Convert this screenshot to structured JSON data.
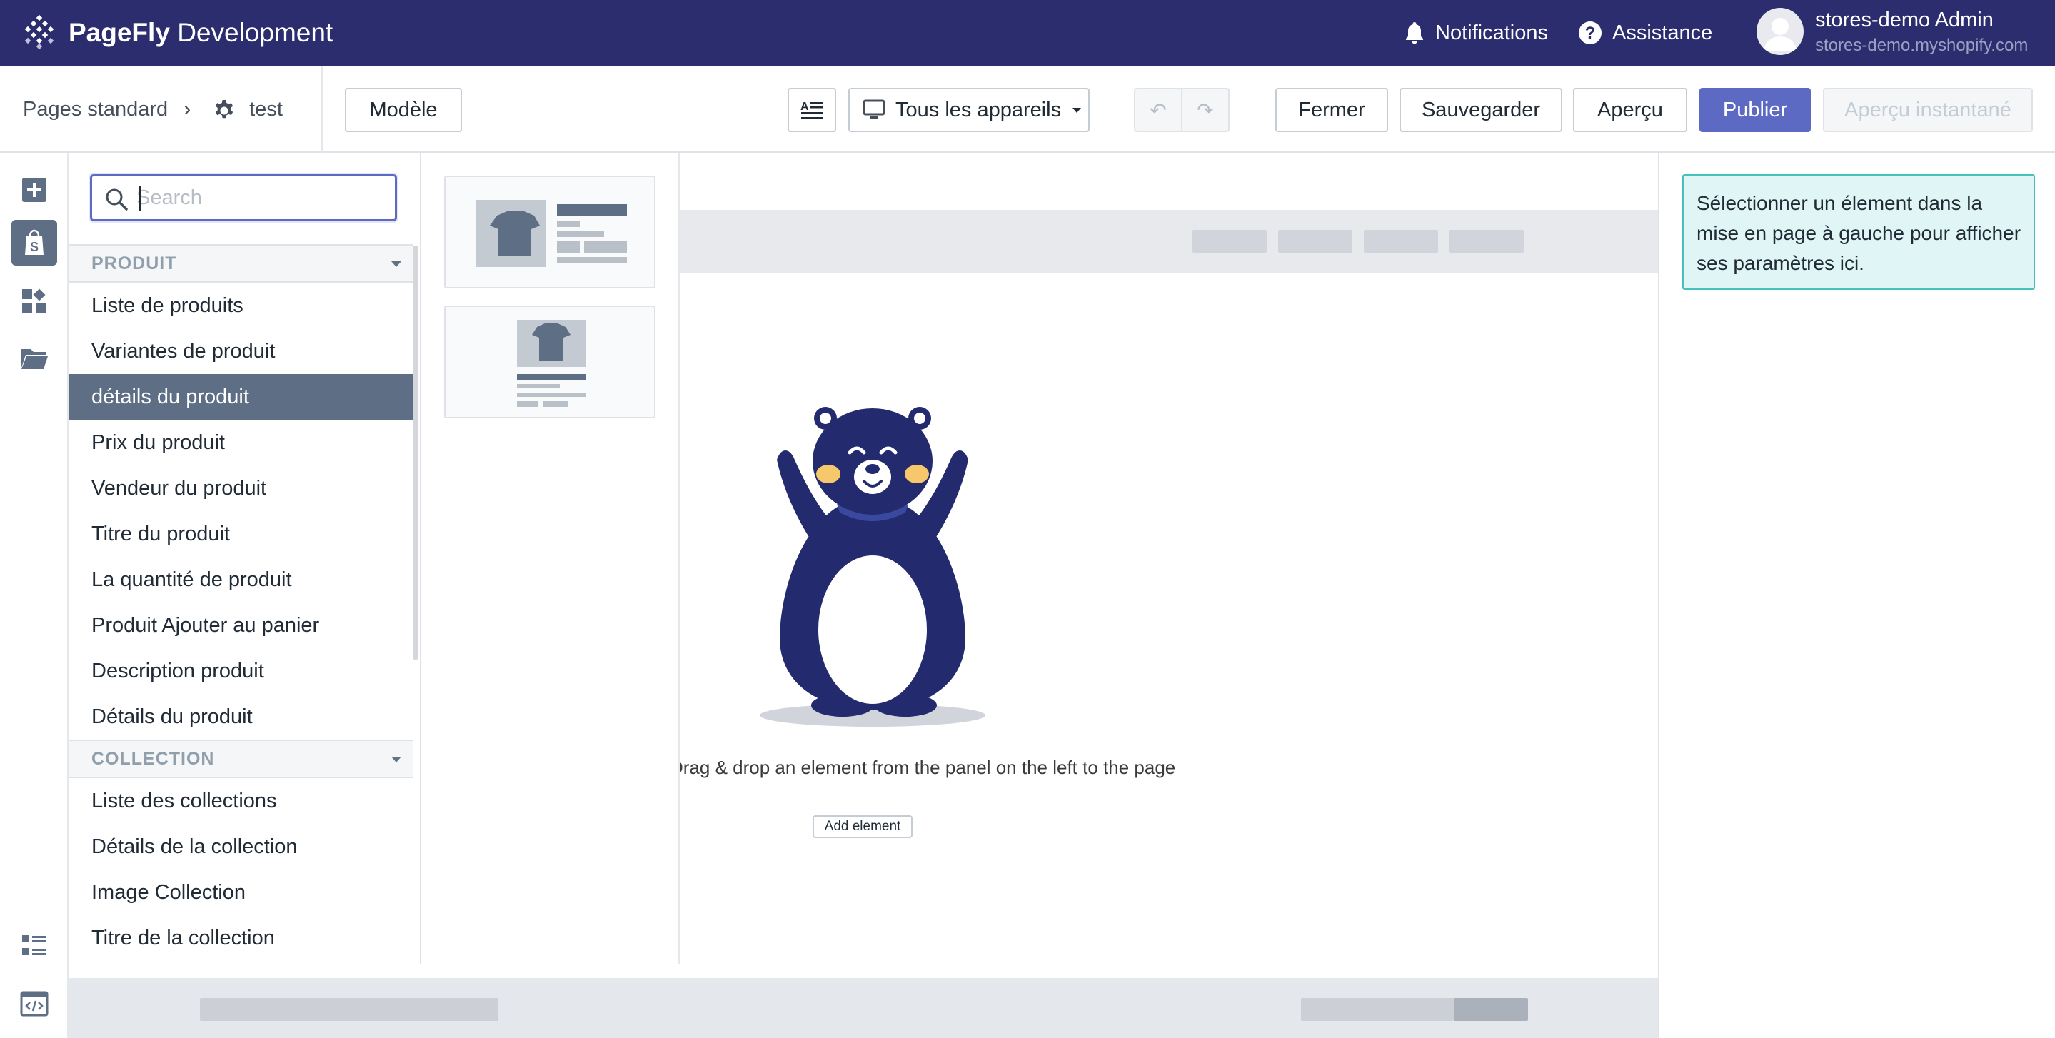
{
  "app": {
    "brand_strong": "PageFly",
    "brand_light": "Development",
    "notifications_label": "Notifications",
    "assistance_label": "Assistance",
    "user_name": "stores-demo Admin",
    "user_store": "stores-demo.myshopify.com"
  },
  "toolbar": {
    "breadcrumb_root": "Pages standard",
    "page_name": "test",
    "template_button": "Modèle",
    "device_select": "Tous les appareils",
    "close_button": "Fermer",
    "save_button": "Sauvegarder",
    "preview_button": "Aperçu",
    "publish_button": "Publier",
    "instant_preview_button": "Aperçu instantané"
  },
  "panel": {
    "search_placeholder": "Search",
    "groups": [
      {
        "title": "PRODUIT",
        "items": [
          "Liste de produits",
          "Variantes de produit",
          "détails du produit",
          "Prix du produit",
          "Vendeur du produit",
          "Titre du produit",
          "La quantité de produit",
          "Produit Ajouter au panier",
          "Description produit",
          "Détails du produit"
        ],
        "selected_index": 2
      },
      {
        "title": "COLLECTION",
        "items": [
          "Liste des collections",
          "Détails de la collection",
          "Image Collection",
          "Titre de la collection"
        ]
      }
    ]
  },
  "canvas": {
    "drop_text": "Drag & drop an element from the panel on the left to the page",
    "add_button": "Add element"
  },
  "right_panel": {
    "info": "Sélectionner un élement dans la mise en page à gauche pour afficher ses paramètres ici."
  },
  "colors": {
    "topbar": "#2b2d6e",
    "primary": "#5c6ac4",
    "selected_item": "#5e6e85",
    "info_bg": "#e0f5f5",
    "info_border": "#47c1bf",
    "bear": "#232b6e"
  },
  "icons": {
    "logo": "pagefly-logo-icon",
    "notifications": "bell-icon",
    "assistance": "question-circle-icon",
    "page_settings": "gear-icon",
    "search": "search-icon",
    "rail": [
      "add-icon",
      "shopify-bag-icon",
      "widgets-icon",
      "folder-icon",
      "list-layout-icon",
      "code-editor-icon"
    ]
  }
}
